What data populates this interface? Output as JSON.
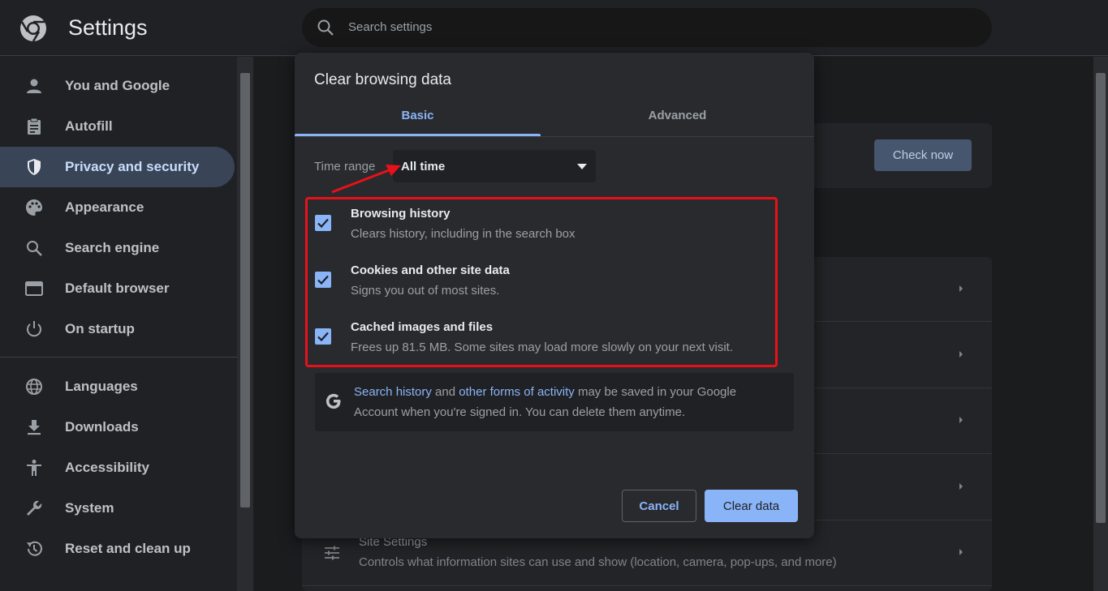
{
  "header": {
    "app_title": "Settings",
    "search_placeholder": "Search settings"
  },
  "sidebar": {
    "items": [
      {
        "label": "You and Google",
        "icon": "person-icon"
      },
      {
        "label": "Autofill",
        "icon": "clipboard-icon"
      },
      {
        "label": "Privacy and security",
        "icon": "shield-icon",
        "active": true
      },
      {
        "label": "Appearance",
        "icon": "palette-icon"
      },
      {
        "label": "Search engine",
        "icon": "search-icon"
      },
      {
        "label": "Default browser",
        "icon": "browser-window-icon"
      },
      {
        "label": "On startup",
        "icon": "power-icon"
      },
      {
        "label": "Languages",
        "icon": "globe-icon"
      },
      {
        "label": "Downloads",
        "icon": "download-icon"
      },
      {
        "label": "Accessibility",
        "icon": "accessibility-icon"
      },
      {
        "label": "System",
        "icon": "wrench-icon"
      },
      {
        "label": "Reset and clean up",
        "icon": "restore-icon"
      }
    ]
  },
  "background": {
    "check_now_label": "Check now",
    "site_settings_title": "Site Settings",
    "site_settings_desc": "Controls what information sites can use and show (location, camera, pop-ups, and more)"
  },
  "dialog": {
    "title": "Clear browsing data",
    "tabs": {
      "basic": "Basic",
      "advanced": "Advanced"
    },
    "time_range_label": "Time range",
    "time_range_value": "All time",
    "items": [
      {
        "title": "Browsing history",
        "desc": "Clears history, including in the search box",
        "checked": true
      },
      {
        "title": "Cookies and other site data",
        "desc": "Signs you out of most sites.",
        "checked": true
      },
      {
        "title": "Cached images and files",
        "desc": "Frees up 81.5 MB. Some sites may load more slowly on your next visit.",
        "checked": true
      }
    ],
    "info": {
      "link1": "Search history",
      "and": " and ",
      "link2": "other forms of activity",
      "rest1": " may be saved in your Google",
      "line2": "Account when you're signed in. You can delete them anytime."
    },
    "cancel_label": "Cancel",
    "clear_label": "Clear data"
  },
  "colors": {
    "accent": "#8ab4f8",
    "annotation": "#e8111a",
    "active_nav_bg": "#394457"
  }
}
